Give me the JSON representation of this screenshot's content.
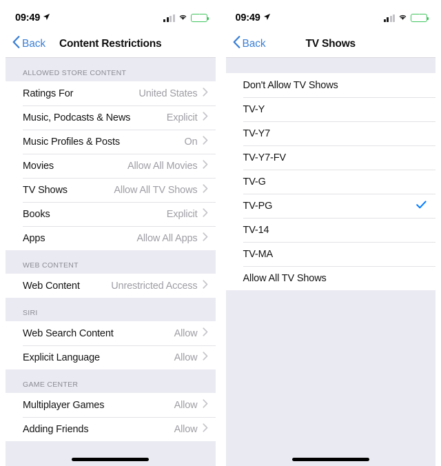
{
  "status_bar": {
    "time": "09:49",
    "location_icon": "location-arrow-icon",
    "signal_icon": "cellular-signal-icon",
    "wifi_icon": "wifi-icon",
    "battery_icon": "battery-charging-icon",
    "battery_color": "#3ec45c"
  },
  "accent_color": "#007aff",
  "left_screen": {
    "nav": {
      "back_label": "Back",
      "title": "Content Restrictions"
    },
    "sections": [
      {
        "header": "ALLOWED STORE CONTENT",
        "rows": [
          {
            "label": "Ratings For",
            "value": "United States"
          },
          {
            "label": "Music, Podcasts & News",
            "value": "Explicit"
          },
          {
            "label": "Music Profiles & Posts",
            "value": "On"
          },
          {
            "label": "Movies",
            "value": "Allow All Movies"
          },
          {
            "label": "TV Shows",
            "value": "Allow All TV Shows"
          },
          {
            "label": "Books",
            "value": "Explicit"
          },
          {
            "label": "Apps",
            "value": "Allow All Apps"
          }
        ]
      },
      {
        "header": "WEB CONTENT",
        "rows": [
          {
            "label": "Web Content",
            "value": "Unrestricted Access"
          }
        ]
      },
      {
        "header": "SIRI",
        "rows": [
          {
            "label": "Web Search Content",
            "value": "Allow"
          },
          {
            "label": "Explicit Language",
            "value": "Allow"
          }
        ]
      },
      {
        "header": "GAME CENTER",
        "rows": [
          {
            "label": "Multiplayer Games",
            "value": "Allow"
          },
          {
            "label": "Adding Friends",
            "value": "Allow"
          }
        ]
      }
    ]
  },
  "right_screen": {
    "nav": {
      "back_label": "Back",
      "title": "TV Shows"
    },
    "options": [
      {
        "label": "Don't Allow TV Shows",
        "selected": false
      },
      {
        "label": "TV-Y",
        "selected": false
      },
      {
        "label": "TV-Y7",
        "selected": false
      },
      {
        "label": "TV-Y7-FV",
        "selected": false
      },
      {
        "label": "TV-G",
        "selected": false
      },
      {
        "label": "TV-PG",
        "selected": true
      },
      {
        "label": "TV-14",
        "selected": false
      },
      {
        "label": "TV-MA",
        "selected": false
      },
      {
        "label": "Allow All TV Shows",
        "selected": false
      }
    ]
  }
}
